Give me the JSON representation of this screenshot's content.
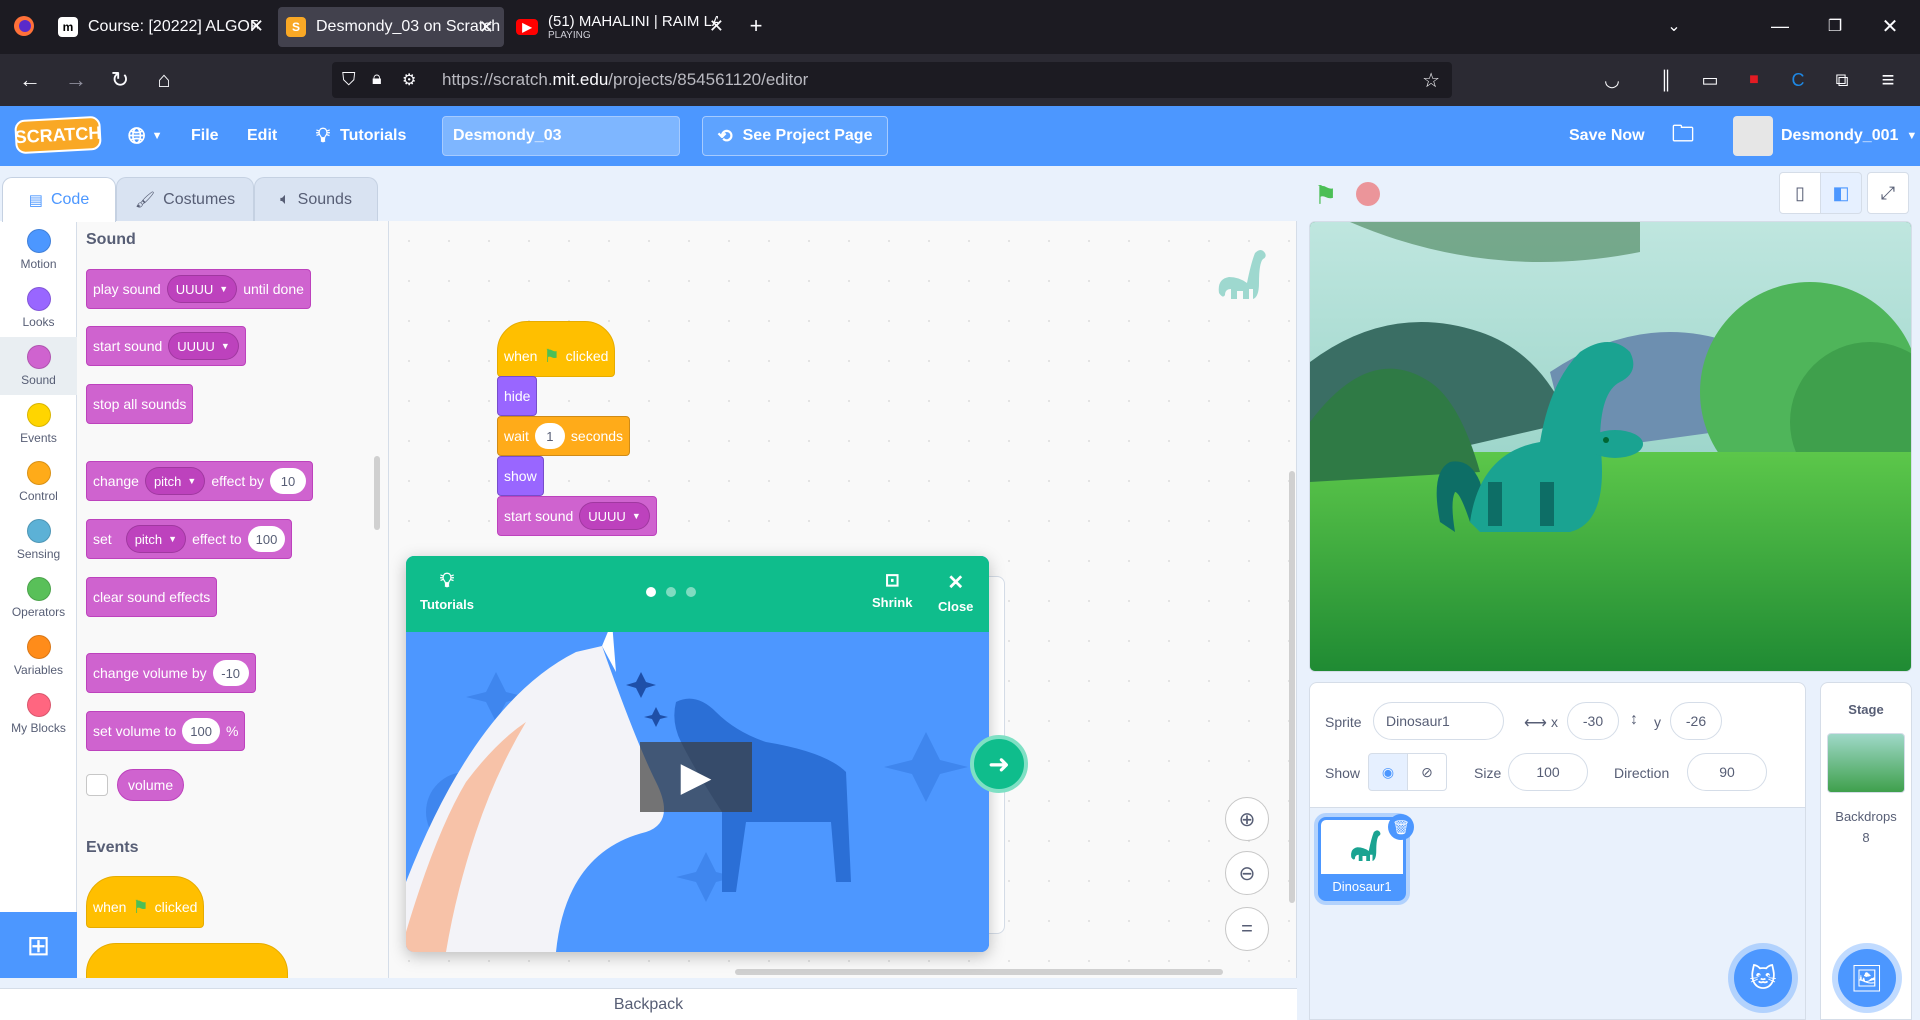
{
  "browser": {
    "tabs": [
      {
        "title": "Course: [20222] ALGORITMA DA",
        "icon": "moodle-icon"
      },
      {
        "title": "Desmondy_03 on Scratch",
        "icon": "scratch-icon"
      },
      {
        "title": "(51) MAHALINI | RAIM LAODE",
        "subtitle": "PLAYING",
        "icon": "youtube-icon"
      }
    ],
    "url_prefix": "https://scratch.",
    "url_domain": "mit.edu",
    "url_path": "/projects/854561120/editor"
  },
  "menubar": {
    "logo": "SCRATCH",
    "file": "File",
    "edit": "Edit",
    "tutorials": "Tutorials",
    "project_title": "Desmondy_03",
    "see_project": "See Project Page",
    "save_now": "Save Now",
    "username": "Desmondy_001"
  },
  "editor_tabs": {
    "code": "Code",
    "costumes": "Costumes",
    "sounds": "Sounds"
  },
  "categories": [
    {
      "label": "Motion",
      "color": "#4c97ff"
    },
    {
      "label": "Looks",
      "color": "#9966ff"
    },
    {
      "label": "Sound",
      "color": "#cf63cf"
    },
    {
      "label": "Events",
      "color": "#ffd500"
    },
    {
      "label": "Control",
      "color": "#ffab19"
    },
    {
      "label": "Sensing",
      "color": "#5cb1d6"
    },
    {
      "label": "Operators",
      "color": "#59c059"
    },
    {
      "label": "Variables",
      "color": "#ff8c1a"
    },
    {
      "label": "My Blocks",
      "color": "#ff6680"
    }
  ],
  "palette": {
    "sound_heading": "Sound",
    "play_sound": "play sound",
    "until_done": "until done",
    "sound_name": "UUUU",
    "start_sound": "start sound",
    "stop_all": "stop all sounds",
    "change": "change",
    "pitch": "pitch",
    "effect_by": "effect by",
    "effect_by_val": "10",
    "set": "set",
    "effect_to": "effect to",
    "effect_to_val": "100",
    "clear_effects": "clear sound effects",
    "change_volume": "change volume by",
    "change_volume_val": "-10",
    "set_volume": "set volume to",
    "set_volume_val": "100",
    "percent": "%",
    "volume": "volume",
    "events_heading": "Events",
    "when": "when",
    "clicked": "clicked"
  },
  "script": {
    "when": "when",
    "clicked": "clicked",
    "hide": "hide",
    "wait": "wait",
    "wait_val": "1",
    "seconds": "seconds",
    "show": "show",
    "start_sound": "start sound",
    "sound_name": "UUUU"
  },
  "tutorial": {
    "tutorials": "Tutorials",
    "shrink": "Shrink",
    "close": "Close"
  },
  "backpack": "Backpack",
  "sprite_info": {
    "sprite_label": "Sprite",
    "sprite_name": "Dinosaur1",
    "x_label": "x",
    "x": "-30",
    "y_label": "y",
    "y": "-26",
    "show_label": "Show",
    "size_label": "Size",
    "size": "100",
    "direction_label": "Direction",
    "direction": "90"
  },
  "sprite_thumb_label": "Dinosaur1",
  "stage_panel": {
    "title": "Stage",
    "backdrops_label": "Backdrops",
    "backdrops_count": "8"
  }
}
